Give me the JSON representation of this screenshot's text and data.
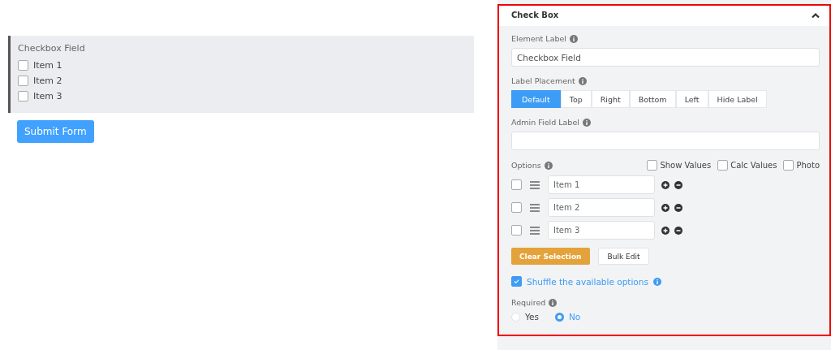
{
  "preview": {
    "label": "Checkbox Field",
    "items": [
      {
        "label": "Item 1",
        "checked": false
      },
      {
        "label": "Item 2",
        "checked": false
      },
      {
        "label": "Item 3",
        "checked": false
      }
    ],
    "submit_button": "Submit Form"
  },
  "panel": {
    "title": "Check Box",
    "expanded": true,
    "element_label": {
      "label": "Element Label",
      "value": "Checkbox Field"
    },
    "label_placement": {
      "label": "Label Placement",
      "options": [
        {
          "label": "Default",
          "selected": true
        },
        {
          "label": "Top",
          "selected": false
        },
        {
          "label": "Right",
          "selected": false
        },
        {
          "label": "Bottom",
          "selected": false
        },
        {
          "label": "Left",
          "selected": false
        },
        {
          "label": "Hide Label",
          "selected": false
        }
      ]
    },
    "admin_field_label": {
      "label": "Admin Field Label"
    },
    "options": {
      "label": "Options",
      "toggles": [
        {
          "label": "Show Values",
          "checked": false
        },
        {
          "label": "Calc Values",
          "checked": false
        },
        {
          "label": "Photo",
          "checked": false
        }
      ],
      "items": [
        {
          "value": "Item 1",
          "checked": false
        },
        {
          "value": "Item 2",
          "checked": false
        },
        {
          "value": "Item 3",
          "checked": false
        }
      ]
    },
    "clear_button": "Clear Selection",
    "bulk_button": "Bulk Edit",
    "shuffle": {
      "label": "Shuffle the available options",
      "checked": true
    },
    "required": {
      "label": "Required",
      "choices": [
        {
          "label": "Yes",
          "selected": false
        },
        {
          "label": "No",
          "selected": true
        }
      ]
    }
  }
}
